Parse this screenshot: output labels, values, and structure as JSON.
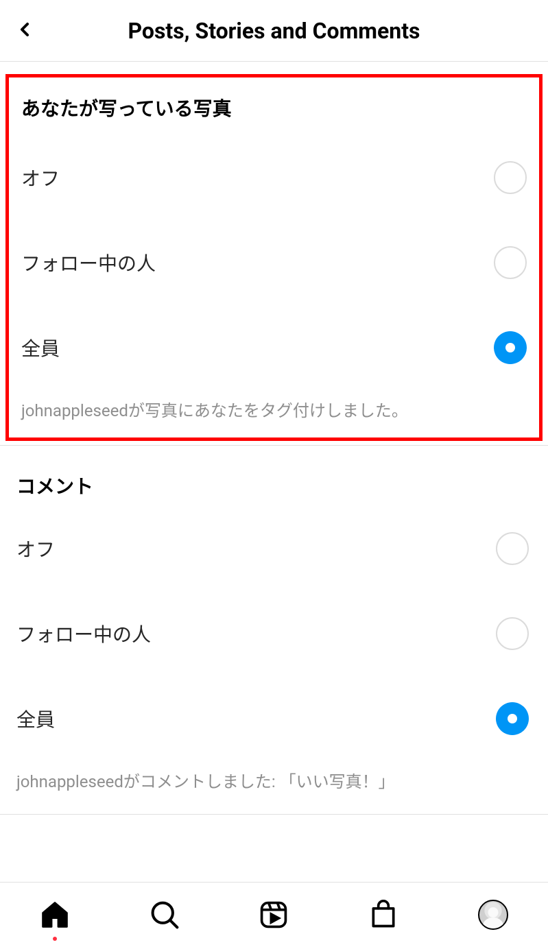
{
  "header": {
    "title": "Posts, Stories and Comments"
  },
  "section1": {
    "title": "あなたが写っている写真",
    "options": [
      {
        "label": "オフ",
        "selected": false
      },
      {
        "label": "フォロー中の人",
        "selected": false
      },
      {
        "label": "全員",
        "selected": true
      }
    ],
    "example": "johnappleseedが写真にあなたをタグ付けしました。"
  },
  "section2": {
    "title": "コメント",
    "options": [
      {
        "label": "オフ",
        "selected": false
      },
      {
        "label": "フォロー中の人",
        "selected": false
      },
      {
        "label": "全員",
        "selected": true
      }
    ],
    "example": "johnappleseedがコメントしました: 「いい写真！」"
  }
}
